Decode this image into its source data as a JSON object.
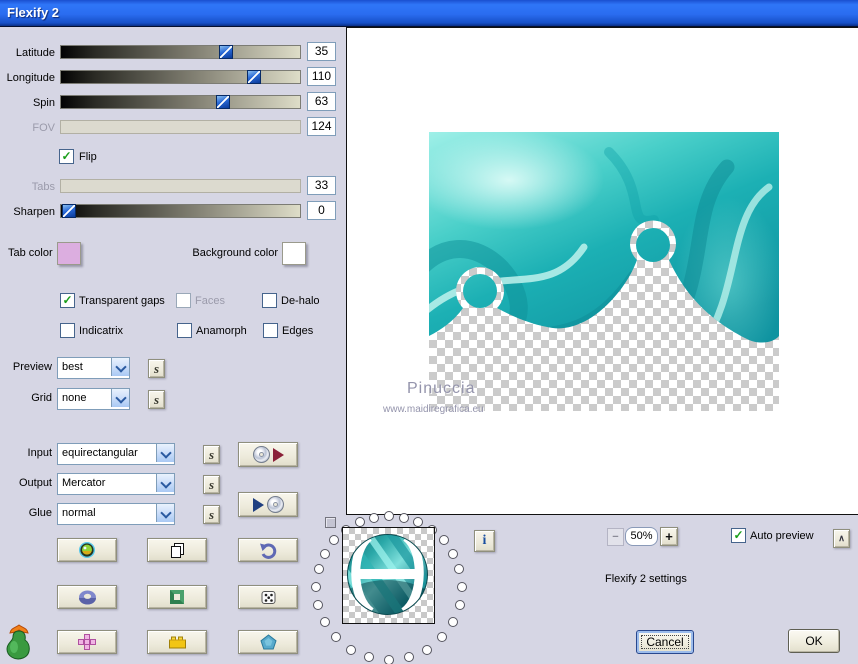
{
  "window": {
    "title": "Flexify 2"
  },
  "accent": {
    "titlebar_blue": "#2a6cf0",
    "teal": "#1fb3b3",
    "button_face": "#ece9da"
  },
  "sliders": [
    {
      "label": "Latitude",
      "value": "35",
      "disabled": false
    },
    {
      "label": "Longitude",
      "value": "110",
      "disabled": false
    },
    {
      "label": "Spin",
      "value": "63",
      "disabled": false
    },
    {
      "label": "FOV",
      "value": "124",
      "disabled": true
    },
    {
      "label": "Tabs",
      "value": "33",
      "disabled": true
    },
    {
      "label": "Sharpen",
      "value": "0",
      "disabled": false
    }
  ],
  "flip": {
    "label": "Flip",
    "check": "✓"
  },
  "color_row": {
    "tab_label": "Tab color",
    "tab_swatch": "#dcaee0",
    "bg_label": "Background color",
    "bg_swatch": "#ffffff"
  },
  "options": {
    "transparent_gaps": {
      "label": "Transparent gaps",
      "check": "✓"
    },
    "faces": {
      "label": "Faces",
      "check": ""
    },
    "dehalo": {
      "label": "De-halo",
      "check": ""
    },
    "indicatrix": {
      "label": "Indicatrix",
      "check": ""
    },
    "anamorph": {
      "label": "Anamorph",
      "check": ""
    },
    "edges": {
      "label": "Edges",
      "check": ""
    }
  },
  "selects": {
    "preview": {
      "label": "Preview",
      "value": "best",
      "s": "s"
    },
    "grid": {
      "label": "Grid",
      "value": "none",
      "s": "s"
    },
    "input": {
      "label": "Input",
      "value": "equirectangular",
      "s": "s"
    },
    "output": {
      "label": "Output",
      "value": "Mercator",
      "s": "s"
    },
    "glue": {
      "label": "Glue",
      "value": "normal",
      "s": "s"
    }
  },
  "footer": {
    "zoom_out": "−",
    "zoom_value": "50%",
    "zoom_in": "+",
    "auto_preview": {
      "label": "Auto preview",
      "check": "✓"
    },
    "collapse_glyph": "∧",
    "info_glyph": "i",
    "settings_caption": "Flexify 2 settings",
    "cancel": "Cancel",
    "ok": "OK"
  },
  "watermark": {
    "line1": "Pinuccia",
    "line2": "www.maidiregrafica.eu"
  },
  "dial": {
    "dot_count": 26
  }
}
